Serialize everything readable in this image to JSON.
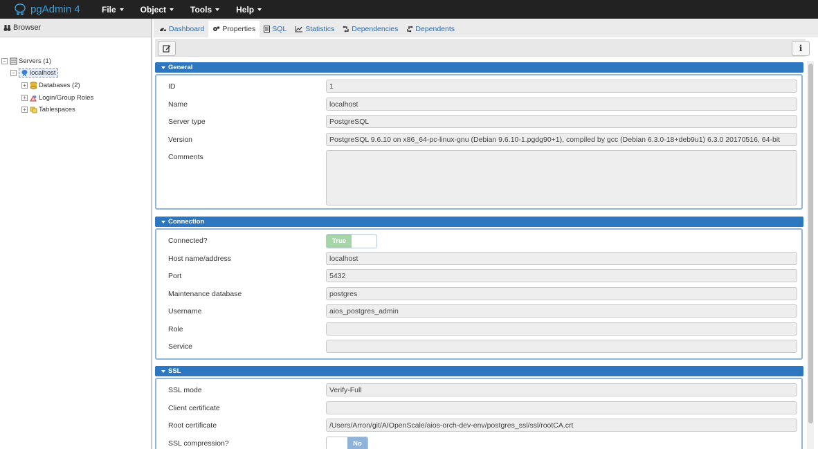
{
  "app": {
    "title": "pgAdmin 4"
  },
  "menu": [
    {
      "label": "File"
    },
    {
      "label": "Object"
    },
    {
      "label": "Tools"
    },
    {
      "label": "Help"
    }
  ],
  "browser": {
    "title": "Browser",
    "tree": {
      "servers": "Servers (1)",
      "localhost": "localhost",
      "databases": "Databases (2)",
      "roles": "Login/Group Roles",
      "tablespaces": "Tablespaces"
    }
  },
  "tabs": [
    {
      "label": "Dashboard",
      "icon": "dashboard-icon"
    },
    {
      "label": "Properties",
      "icon": "gears-icon",
      "active": true
    },
    {
      "label": "SQL",
      "icon": "file-icon"
    },
    {
      "label": "Statistics",
      "icon": "line-chart-icon"
    },
    {
      "label": "Dependencies",
      "icon": "dependencies-icon"
    },
    {
      "label": "Dependents",
      "icon": "dependents-icon"
    }
  ],
  "toolbar": {
    "edit_icon": "edit-icon",
    "info_label": "i"
  },
  "sections": {
    "general": {
      "title": "General",
      "id_label": "ID",
      "id_value": "1",
      "name_label": "Name",
      "name_value": "localhost",
      "type_label": "Server type",
      "type_value": "PostgreSQL",
      "version_label": "Version",
      "version_value": "PostgreSQL 9.6.10 on x86_64-pc-linux-gnu (Debian 9.6.10-1.pgdg90+1), compiled by gcc (Debian 6.3.0-18+deb9u1) 6.3.0 20170516, 64-bit",
      "comments_label": "Comments",
      "comments_value": ""
    },
    "connection": {
      "title": "Connection",
      "connected_label": "Connected?",
      "connected_value": "True",
      "host_label": "Host name/address",
      "host_value": "localhost",
      "port_label": "Port",
      "port_value": "5432",
      "maintdb_label": "Maintenance database",
      "maintdb_value": "postgres",
      "username_label": "Username",
      "username_value": "aios_postgres_admin",
      "role_label": "Role",
      "role_value": "",
      "service_label": "Service",
      "service_value": ""
    },
    "ssl": {
      "title": "SSL",
      "mode_label": "SSL mode",
      "mode_value": "Verify-Full",
      "client_cert_label": "Client certificate",
      "client_cert_value": "",
      "root_cert_label": "Root certificate",
      "root_cert_value": "/Users/Arron/git/AIOpenScale/aios-orch-dev-env/postgres_ssl/ssl/rootCA.crt",
      "compression_label": "SSL compression?",
      "compression_value": "No"
    }
  }
}
